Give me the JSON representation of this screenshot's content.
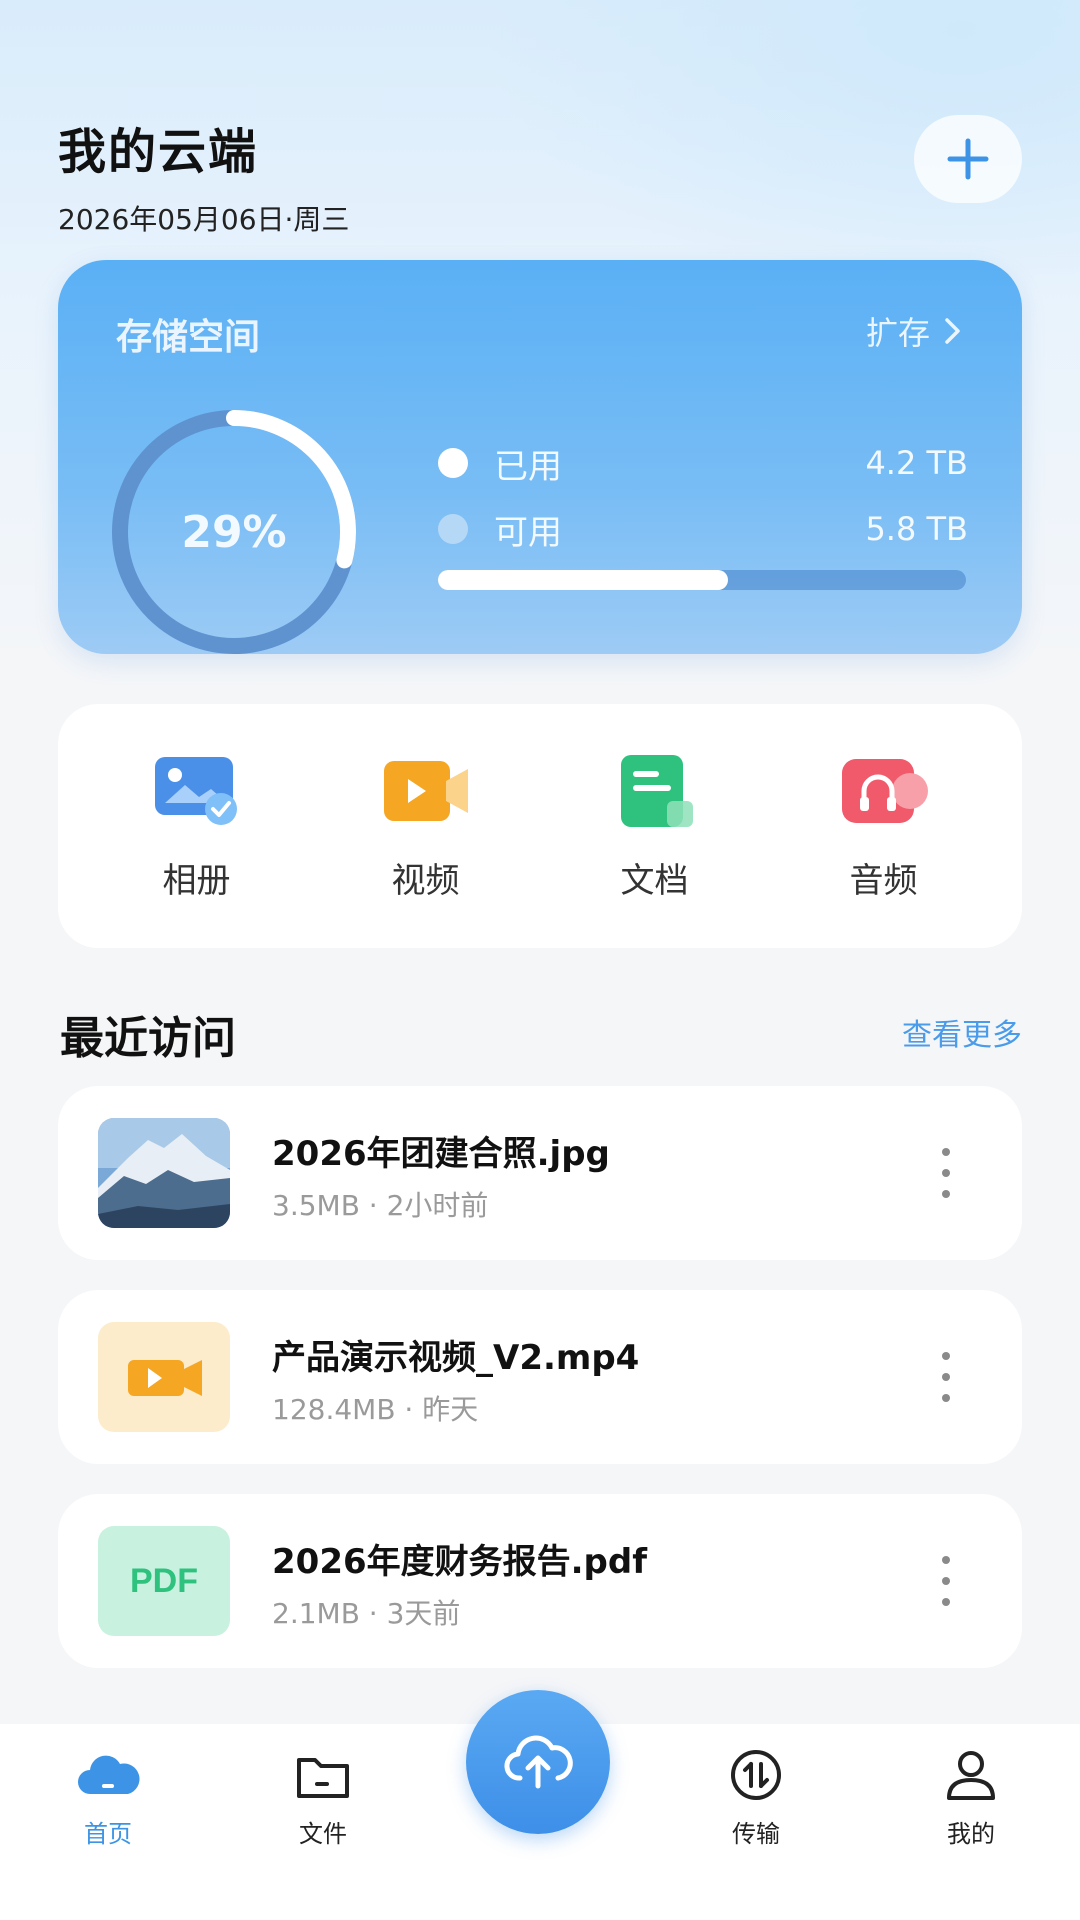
{
  "header": {
    "title": "我的云端",
    "date": "2026年05月06日·周三"
  },
  "storage": {
    "title": "存储空间",
    "expand_label": "扩存",
    "percent_label": "29%",
    "used_fraction": 0.29,
    "used_label": "已用",
    "used_value": "4.2 TB",
    "available_label": "可用",
    "available_value": "5.8 TB",
    "bar_fill_fraction": 0.55
  },
  "categories": [
    {
      "label": "相册",
      "icon": "album-icon",
      "color": "#4a90e8"
    },
    {
      "label": "视频",
      "icon": "video-icon",
      "color": "#f5a623"
    },
    {
      "label": "文档",
      "icon": "document-icon",
      "color": "#2ec27e"
    },
    {
      "label": "音频",
      "icon": "audio-icon",
      "color": "#f05a6a"
    }
  ],
  "recent": {
    "title": "最近访问",
    "see_more": "查看更多",
    "files": [
      {
        "name": "2026年团建合照.jpg",
        "meta": "3.5MB · 2小时前",
        "icon": "image-thumbnail"
      },
      {
        "name": "产品演示视频_V2.mp4",
        "meta": "128.4MB · 昨天",
        "icon": "video-file-icon"
      },
      {
        "name": "2026年度财务报告.pdf",
        "meta": "2.1MB · 3天前",
        "icon": "pdf-file-icon",
        "badge": "PDF"
      }
    ]
  },
  "tabbar": {
    "items": [
      {
        "label": "首页",
        "icon": "home-cloud-icon",
        "active": true
      },
      {
        "label": "文件",
        "icon": "folder-icon",
        "active": false
      },
      {
        "label": "传输",
        "icon": "transfer-icon",
        "active": false
      },
      {
        "label": "我的",
        "icon": "user-icon",
        "active": false
      }
    ],
    "upload_icon": "cloud-upload-icon"
  },
  "colors": {
    "accent": "#3d94e6",
    "card_gradient_top": "#5ab0f5",
    "card_gradient_bottom": "#9dcbf5"
  }
}
